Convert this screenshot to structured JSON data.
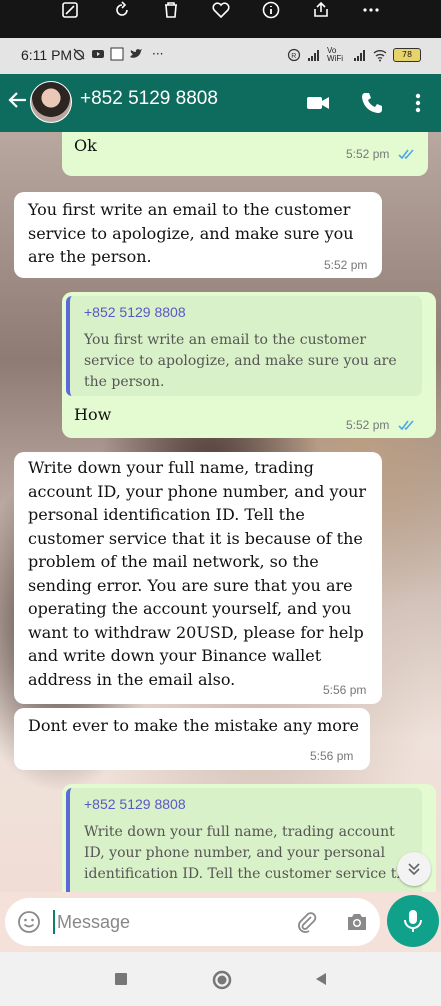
{
  "viewer_toolbar": {
    "icons": [
      "edit-image-icon",
      "rotate-icon",
      "delete-icon",
      "favorite-icon",
      "info-icon",
      "share-icon",
      "more-icon"
    ]
  },
  "status_bar": {
    "time": "6:11 PM",
    "battery": "78",
    "network": "Vo WiFi"
  },
  "header": {
    "contact": "+852 5129 8808"
  },
  "messages": [
    {
      "dir": "out",
      "text": "Ok",
      "time": "5:52 pm"
    },
    {
      "dir": "in",
      "text": "You first write an email to the customer service to apologize, and make sure you are the person.",
      "time": "5:52 pm"
    },
    {
      "dir": "out",
      "quote_name": "+852 5129 8808",
      "quote_text": "You first write an email to the customer service to apologize, and make sure you are the person.",
      "text": "How",
      "time": "5:52 pm"
    },
    {
      "dir": "in",
      "text": "Write down your full name, trading account ID, your phone number, and your personal identification ID. Tell the customer service that it is because of the problem of the mail network, so the sending error. You are sure that you are operating the account yourself, and you want to withdraw 20USD, please for help and write down your Binance wallet address in the email also.",
      "time": "5:56 pm"
    },
    {
      "dir": "in",
      "text": "Dont ever to make the mistake any more",
      "time": "5:56 pm"
    },
    {
      "dir": "out",
      "quote_name": "+852 5129 8808",
      "quote_text": "Write down your full name, trading account ID, your phone number, and your personal identification ID. Tell the customer service th"
    }
  ],
  "input": {
    "placeholder": "Message"
  },
  "colors": {
    "header": "#0e6c5e",
    "outgoing": "#e4fbd2",
    "incoming": "#ffffff",
    "mic": "#10a18a",
    "quote_bar": "#5c6ad6",
    "read_ticks": "#4fa6e6"
  }
}
